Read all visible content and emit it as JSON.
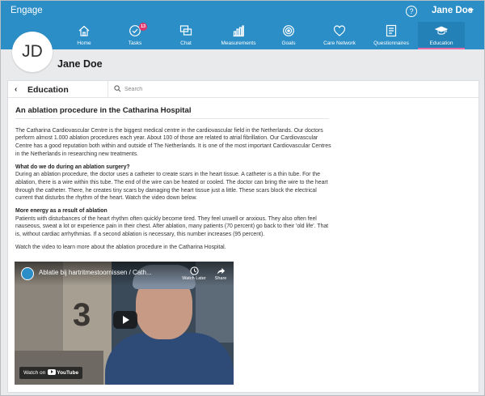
{
  "app": {
    "title": "Engage"
  },
  "user": {
    "name": "Jane Doe",
    "initials": "JD"
  },
  "nav": {
    "items": [
      {
        "label": "Home",
        "icon": "home-icon"
      },
      {
        "label": "Tasks",
        "icon": "check-circle-icon",
        "badge": "13"
      },
      {
        "label": "Chat",
        "icon": "chat-icon"
      },
      {
        "label": "Measurements",
        "icon": "bar-chart-icon"
      },
      {
        "label": "Goals",
        "icon": "target-icon"
      },
      {
        "label": "Care Network",
        "icon": "heart-icon"
      },
      {
        "label": "Questionnaires",
        "icon": "clipboard-icon"
      },
      {
        "label": "Education",
        "icon": "graduation-cap-icon",
        "active": true
      }
    ]
  },
  "section": {
    "title": "Education",
    "back_icon": "chevron-left-icon"
  },
  "search": {
    "placeholder": "Search",
    "icon": "search-icon"
  },
  "article": {
    "title": "An ablation procedure in the Catharina Hospital",
    "intro": "The Catharina Cardiovascular Centre is the biggest medical centre in the cardiovascular field in the Netherlands. Our doctors perform almost 1.000 ablation procedures each year. About 100 of those are related to atrial fibrillation. Our Cardiovascular Centre has a good reputation both within and outside of The Netherlands. It is one of the most important Cardiovascular Centres in the Netherlands in researching new treatments.",
    "heading1": "What do we do during an ablation surgery?",
    "para1": "During an ablation procedure, the doctor uses a catheter to create scars in the heart tissue. A catheter is a thin tube. For the ablation, there is a wire within this tube. The end of the wire can be heated or cooled. The doctor can bring the wire to the heart through the catheter. There, he creates tiny scars by damaging the heart tissue just a little. These scars block the electrical current that disturbs the rhythm of the heart. Watch the video down below.",
    "heading2": "More energy as a result of ablation",
    "para2": "Patients with disturbances of the heart rhythm often quickly become tired. They feel unwell or anxious. They also often feel nauseous, sweat a lot or experience pain in their chest. After ablation, many patients (70 percent) go back to their 'old life'. That is, without cardiac arrhythmias. If a second ablation is necessary, this number increases (95 percent).",
    "outro": "Watch the video to learn more about the ablation procedure in the Catharina Hospital."
  },
  "video": {
    "title": "Ablatie bij hartritmestoornissen / Cath...",
    "watch_later": "Watch Later",
    "share": "Share",
    "watch_on": "Watch on",
    "youtube": "YouTube",
    "frame_digit": "3"
  },
  "colors": {
    "brand": "#2b8ec7",
    "active_underline": "#e26aa8",
    "badge": "#e0356b"
  }
}
